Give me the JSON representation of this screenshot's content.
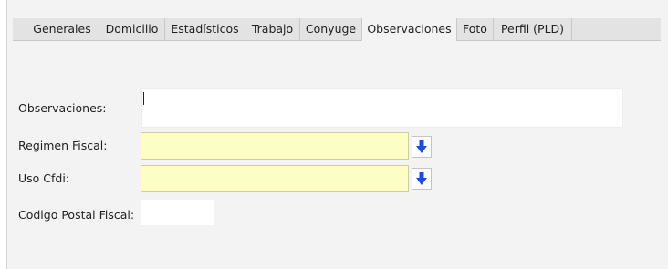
{
  "tabs": [
    {
      "label": "Generales",
      "active": false
    },
    {
      "label": "Domicilio",
      "active": false
    },
    {
      "label": "Estadísticos",
      "active": false
    },
    {
      "label": "Trabajo",
      "active": false
    },
    {
      "label": "Conyuge",
      "active": false
    },
    {
      "label": "Observaciones",
      "active": true
    },
    {
      "label": "Foto",
      "active": false
    },
    {
      "label": "Perfil (PLD)",
      "active": false
    }
  ],
  "form": {
    "observaciones_label": "Observaciones:",
    "observaciones_value": "",
    "regimen_label": "Regimen Fiscal:",
    "regimen_value": "",
    "uso_cfdi_label": "Uso Cfdi:",
    "uso_cfdi_value": "",
    "codigo_postal_label": "Codigo Postal Fiscal:",
    "codigo_postal_value": ""
  },
  "icons": {
    "dropdown": "arrow-down-icon"
  },
  "colors": {
    "select_bg": "#fdfdc6",
    "arrow": "#1a4fd8"
  }
}
